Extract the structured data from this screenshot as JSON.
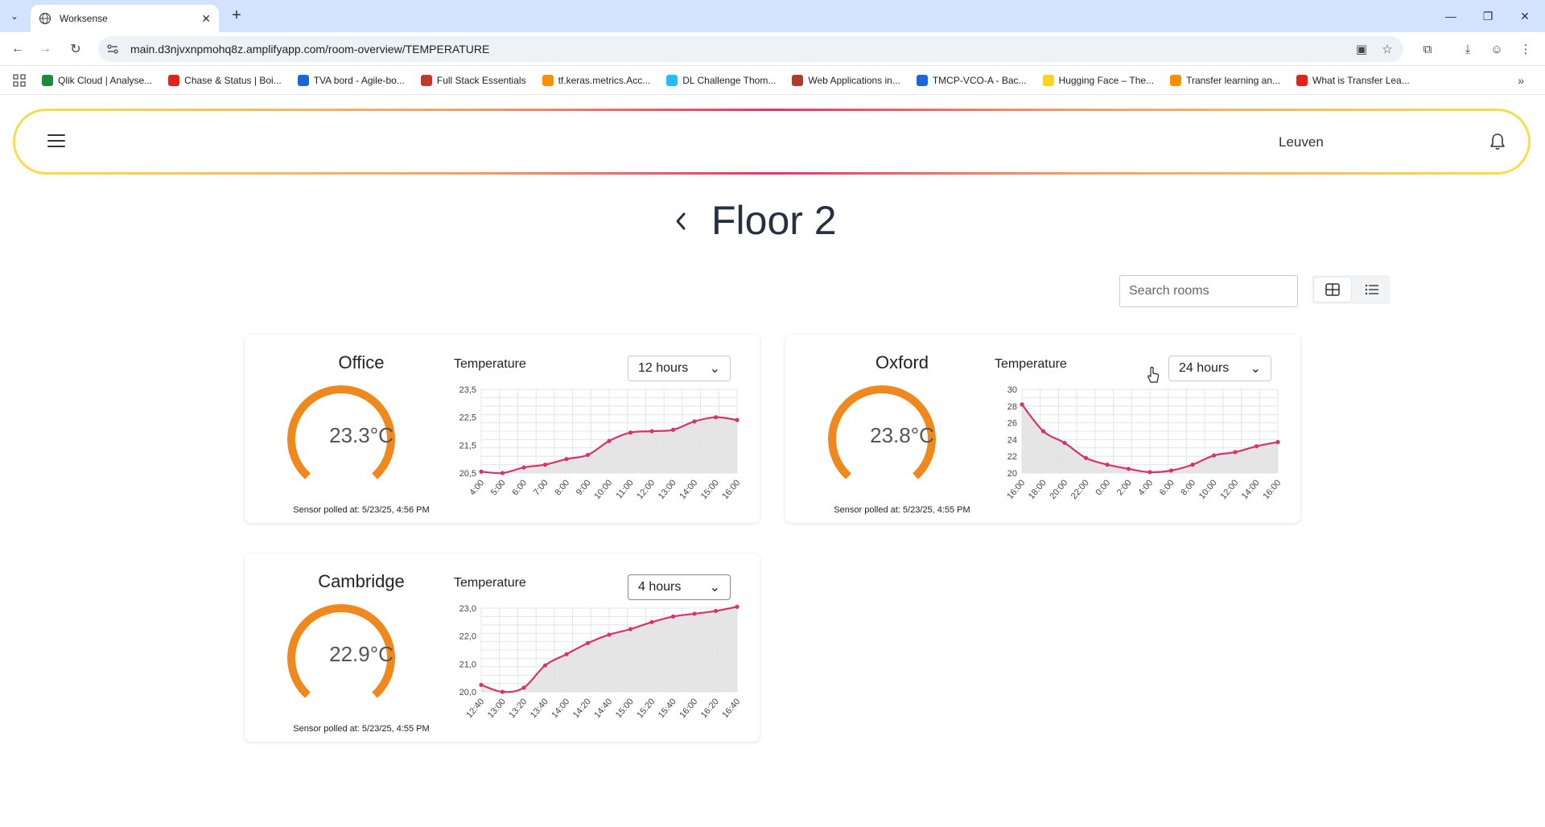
{
  "browser": {
    "tab_title": "Worksense",
    "url": "main.d3njvxnpmohq8z.amplifyapp.com/room-overview/TEMPERATURE",
    "bookmarks": [
      {
        "label": "Qlik Cloud | Analyse...",
        "color": "#1a8a3c"
      },
      {
        "label": "Chase & Status | Boi...",
        "color": "#e62117"
      },
      {
        "label": "TVA bord - Agile-bo...",
        "color": "#1868db"
      },
      {
        "label": "Full Stack Essentials",
        "color": "#c0392b"
      },
      {
        "label": "tf.keras.metrics.Acc...",
        "color": "#ff8f00"
      },
      {
        "label": "DL Challenge Thom...",
        "color": "#20beff"
      },
      {
        "label": "Web Applications in...",
        "color": "#b03a2e"
      },
      {
        "label": "TMCP-VCO-A - Bac...",
        "color": "#1868db"
      },
      {
        "label": "Hugging Face – The...",
        "color": "#ffd21e"
      },
      {
        "label": "Transfer learning an...",
        "color": "#ff8f00"
      },
      {
        "label": "What is Transfer Lea...",
        "color": "#e62117"
      }
    ]
  },
  "header": {
    "location": "Leuven"
  },
  "page": {
    "title": "Floor 2",
    "search_placeholder": "Search rooms"
  },
  "colors": {
    "gauge": "#f0891d",
    "line": "#d6336c",
    "area": "#e2e2e2",
    "grid": "#e4e4e4"
  },
  "rooms": [
    {
      "name": "Office",
      "temperature": "23.3°C",
      "polled": "Sensor polled at: 5/23/25, 4:56 PM",
      "chart_label": "Temperature",
      "range": "12 hours"
    },
    {
      "name": "Oxford",
      "temperature": "23.8°C",
      "polled": "Sensor polled at: 5/23/25, 4:55 PM",
      "chart_label": "Temperature",
      "range": "24 hours"
    },
    {
      "name": "Cambridge",
      "temperature": "22.9°C",
      "polled": "Sensor polled at: 5/23/25, 4:55 PM",
      "chart_label": "Temperature",
      "range": "4 hours"
    }
  ],
  "chart_data": [
    {
      "type": "area",
      "title": "Temperature",
      "x": [
        "4:00",
        "5:00",
        "6:00",
        "7:00",
        "8:00",
        "9:00",
        "10:00",
        "11:00",
        "12:00",
        "13:00",
        "14:00",
        "15:00",
        "16:00"
      ],
      "y": [
        20.55,
        20.5,
        20.7,
        20.8,
        21.0,
        21.15,
        21.65,
        21.95,
        22.0,
        22.05,
        22.35,
        22.5,
        22.4
      ],
      "y_ticks": [
        "20,5",
        "21,5",
        "22,5",
        "23,5"
      ],
      "y_tick_values": [
        20.5,
        21.5,
        22.5,
        23.5
      ],
      "ylim": [
        20.5,
        23.5
      ]
    },
    {
      "type": "area",
      "title": "Temperature",
      "x": [
        "16:00",
        "17:00",
        "18:00",
        "19:00",
        "20:00",
        "21:00",
        "22:00",
        "23:00",
        "0:00",
        "1:00",
        "2:00",
        "3:00",
        "4:00",
        "5:00",
        "6:00",
        "7:00",
        "8:00",
        "9:00",
        "10:00",
        "11:00",
        "12:00",
        "13:00",
        "14:00",
        "15:00",
        "16:00"
      ],
      "x_tick_labels": [
        "16:00",
        "18:00",
        "20:00",
        "22:00",
        "0:00",
        "2:00",
        "4:00",
        "6:00",
        "8:00",
        "10:00",
        "12:00",
        "14:00",
        "16:00"
      ],
      "y": [
        28.2,
        null,
        25.0,
        null,
        23.6,
        null,
        21.8,
        null,
        21.0,
        null,
        20.5,
        null,
        20.1,
        null,
        20.3,
        null,
        21.0,
        null,
        22.1,
        null,
        22.5,
        null,
        23.2,
        null,
        23.7
      ],
      "y_ticks": [
        "20",
        "22",
        "24",
        "26",
        "28",
        "30"
      ],
      "y_tick_values": [
        20,
        22,
        24,
        26,
        28,
        30
      ],
      "ylim": [
        20,
        30
      ]
    },
    {
      "type": "area",
      "title": "Temperature",
      "x": [
        "12:40",
        "13:00",
        "13:20",
        "13:40",
        "14:00",
        "14:20",
        "14:40",
        "15:00",
        "15:20",
        "15:40",
        "16:00",
        "16:20",
        "16:40"
      ],
      "y": [
        20.25,
        20.0,
        20.15,
        20.95,
        21.35,
        21.75,
        22.05,
        22.25,
        22.5,
        22.7,
        22.8,
        22.9,
        23.05
      ],
      "y_ticks": [
        "20,0",
        "21,0",
        "22,0",
        "23,0"
      ],
      "y_tick_values": [
        20.0,
        21.0,
        22.0,
        23.0
      ],
      "ylim": [
        20.0,
        23.0
      ]
    }
  ]
}
